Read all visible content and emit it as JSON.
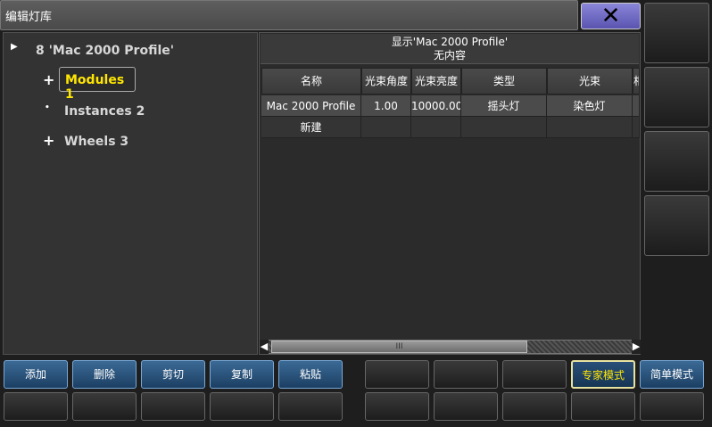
{
  "window": {
    "title": "编辑灯库",
    "close_icon": "close-icon"
  },
  "tree": {
    "root_label": "8 'Mac 2000 Profile'",
    "items": [
      {
        "label": "Modules 1",
        "glyph": "+"
      },
      {
        "label": "Instances 2",
        "glyph": "•"
      },
      {
        "label": "Wheels 3",
        "glyph": "+"
      }
    ]
  },
  "table": {
    "title_line1": "显示'Mac 2000 Profile'",
    "title_line2": "无内容",
    "columns": [
      "名称",
      "光束角度",
      "光束亮度",
      "类型",
      "光束",
      "相"
    ],
    "rows": [
      [
        "Mac 2000 Profile",
        "1.00",
        "10000.00",
        "摇头灯",
        "染色灯",
        ""
      ],
      [
        "新建",
        "",
        "",
        "",
        "",
        ""
      ]
    ],
    "scroll_thumb_label": "III"
  },
  "buttons": {
    "add": "添加",
    "delete": "删除",
    "cut": "剪切",
    "copy": "复制",
    "paste": "粘贴",
    "expert_mode": "专家模式",
    "simple_mode": "简单模式"
  },
  "colors": {
    "accent_yellow": "#ffe600",
    "button_blue": "#2a5580",
    "close_purple": "#6e68c8"
  }
}
